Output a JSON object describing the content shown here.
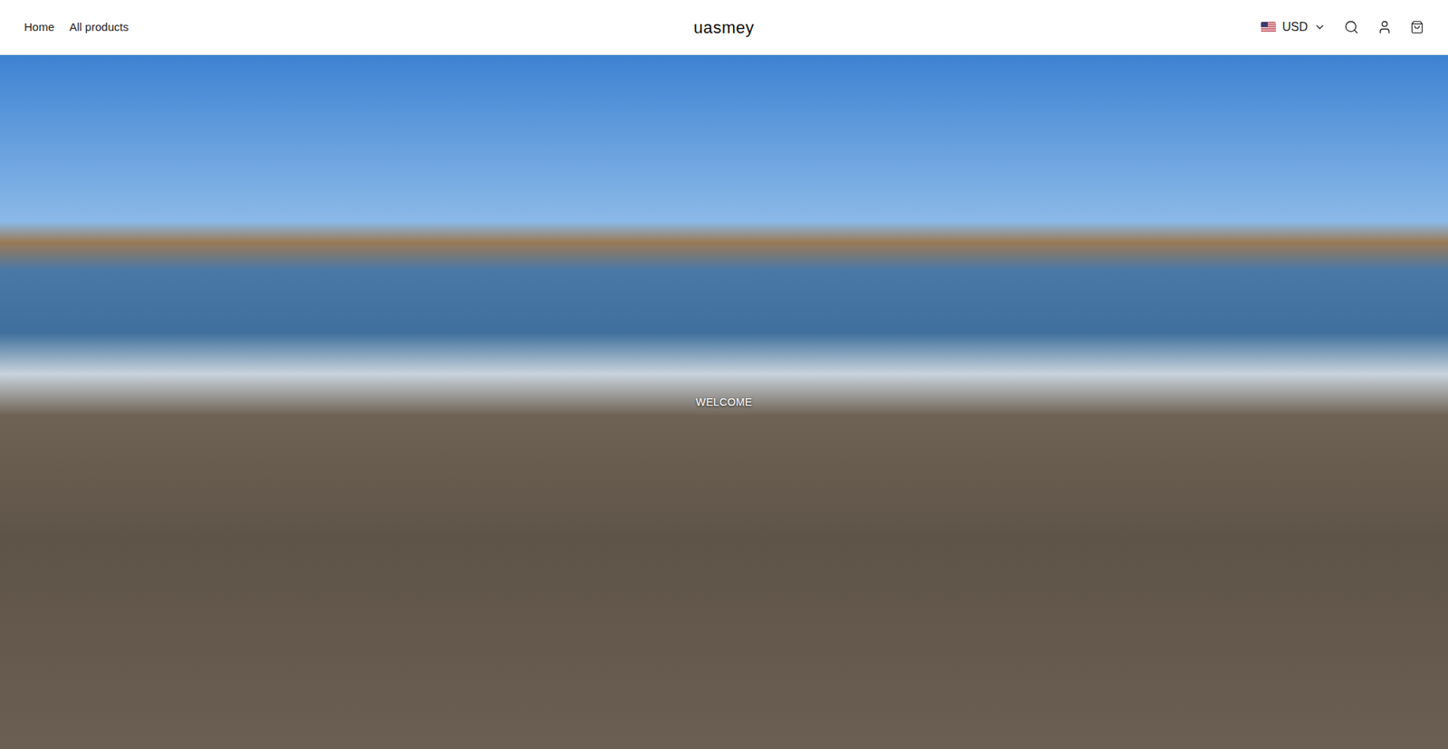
{
  "header": {
    "nav": [
      {
        "label": "Home",
        "selected": false
      },
      {
        "label": "All products",
        "selected": false
      }
    ],
    "logo": "uasmey",
    "currency": "USD"
  },
  "hero": {
    "text": "WELCOME"
  }
}
